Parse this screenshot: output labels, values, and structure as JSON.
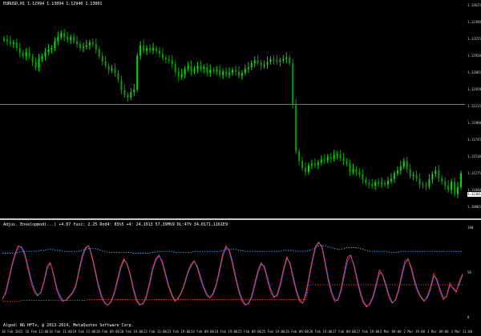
{
  "chart": {
    "symbol_header": "EURUSD,H1  1.12994 1.13094 1.12940 1.13001",
    "indicator_header": "Adjus. Envelopmod(...) +4.07 fusc: 2.25 Rnd4: 85%5 +4: 24.1913 57.39M%9 DL:47% 34.0171.1161E9",
    "copyright": "Algod: NG HFTs, @ 2013-2014, MetaQuotes Software Corp.",
    "current_price": "1.12301",
    "colors": {
      "bull": "#00e000",
      "bear": "#00a000",
      "line1": "#ff3030",
      "line2": "#3a6cff",
      "env_upper": "#3fa9ff",
      "env_lower": "#ff3030"
    },
    "price_axis": [
      "1.13625",
      "1.13390",
      "1.13155",
      "1.12920",
      "1.12685",
      "1.12450",
      "1.12215",
      "1.11980",
      "1.11745",
      "1.11510",
      "1.11275",
      "1.11040",
      "1.10805"
    ],
    "indicator_axis": [
      "100",
      "50",
      "0"
    ],
    "time_axis": [
      "10 Feb 2015",
      "16 Feb 11:00",
      "18 Feb 11:00",
      "19 Feb 15:00",
      "20 Feb 09:00",
      "20 Feb 19:00",
      "23 Feb 11:00",
      "23 Feb 19:00",
      "24 Feb 09:00",
      "24 Feb 19:00",
      "25 Feb 09:00",
      "25 Feb 19:00",
      "26 Feb 09:00",
      "26 Feb 19:00",
      "27 Feb 09:00",
      "27 Feb 19:00",
      "2 Mar 09:00",
      "2 Mar 19:00",
      "3 Mar 09:00",
      "3 Mar 11:00"
    ]
  },
  "chart_data": {
    "type": "candlestick",
    "title": "EURUSD,H1",
    "ylim": [
      1.1075,
      1.1368
    ],
    "close": [
      1.1325,
      1.1322,
      1.1318,
      1.132,
      1.1312,
      1.1305,
      1.13,
      1.1306,
      1.13,
      1.1292,
      1.1284,
      1.1296,
      1.13,
      1.1306,
      1.131,
      1.1312,
      1.1322,
      1.1328,
      1.1334,
      1.1328,
      1.1324,
      1.1328,
      1.1322,
      1.1318,
      1.1312,
      1.1314,
      1.1316,
      1.132,
      1.1318,
      1.131,
      1.13,
      1.1293,
      1.1286,
      1.128,
      1.1282,
      1.1276,
      1.1266,
      1.1251,
      1.1244,
      1.124,
      1.1248,
      1.1252,
      1.1301,
      1.1316,
      1.1308,
      1.1312,
      1.1309,
      1.1312,
      1.1308,
      1.1304,
      1.1298,
      1.1296,
      1.1294,
      1.1289,
      1.1278,
      1.127,
      1.1274,
      1.1282,
      1.1286,
      1.1278,
      1.1282,
      1.1286,
      1.1282,
      1.1284,
      1.1276,
      1.128,
      1.1279,
      1.128,
      1.1273,
      1.1278,
      1.1274,
      1.1276,
      1.128,
      1.1278,
      1.1272,
      1.1276,
      1.1282,
      1.1284,
      1.129,
      1.1294,
      1.1291,
      1.1286,
      1.1288,
      1.1292,
      1.1296,
      1.1294,
      1.1292,
      1.1294,
      1.1296,
      1.1298,
      1.129,
      1.123,
      1.1162,
      1.1148,
      1.1138,
      1.1132,
      1.1142,
      1.1144,
      1.1142,
      1.1146,
      1.115,
      1.1149,
      1.1154,
      1.1151,
      1.1156,
      1.1158,
      1.1152,
      1.1148,
      1.1144,
      1.1132,
      1.1136,
      1.1132,
      1.1128,
      1.1121,
      1.1116,
      1.1114,
      1.1112,
      1.1117,
      1.1115,
      1.1116,
      1.1114,
      1.1119,
      1.1122,
      1.113,
      1.1134,
      1.114,
      1.1148,
      1.1136,
      1.1126,
      1.1128,
      1.1122,
      1.1114,
      1.1112,
      1.1111,
      1.1121,
      1.1129,
      1.1134,
      1.1123,
      1.1118,
      1.1112,
      1.1106,
      1.1118,
      1.11,
      1.111,
      1.113
    ],
    "ind1": [
      22,
      30,
      45,
      60,
      72,
      80,
      78,
      70,
      55,
      40,
      30,
      26,
      30,
      42,
      58,
      62,
      48,
      32,
      24,
      20,
      22,
      26,
      30,
      38,
      55,
      70,
      78,
      80,
      68,
      52,
      36,
      24,
      18,
      16,
      20,
      30,
      44,
      58,
      66,
      60,
      48,
      32,
      20,
      16,
      18,
      26,
      40,
      56,
      66,
      70,
      62,
      48,
      36,
      26,
      20,
      24,
      30,
      40,
      52,
      60,
      64,
      56,
      44,
      34,
      26,
      24,
      30,
      40,
      56,
      72,
      80,
      74,
      60,
      44,
      30,
      20,
      16,
      18,
      26,
      40,
      54,
      62,
      56,
      42,
      30,
      24,
      28,
      40,
      56,
      68,
      60,
      44,
      30,
      20,
      18,
      30,
      48,
      66,
      80,
      84,
      78,
      60,
      42,
      28,
      20,
      22,
      34,
      52,
      68,
      70,
      58,
      42,
      28,
      18,
      14,
      18,
      26,
      40,
      54,
      48,
      36,
      24,
      18,
      22,
      34,
      50,
      64,
      66,
      54,
      40,
      30,
      24,
      20,
      26,
      36,
      50,
      42,
      30,
      22,
      26,
      40,
      34,
      30,
      42,
      50
    ],
    "ind2": [
      24,
      28,
      42,
      58,
      70,
      79,
      79,
      72,
      58,
      44,
      33,
      27,
      29,
      40,
      55,
      61,
      50,
      35,
      26,
      21,
      21,
      25,
      29,
      36,
      52,
      67,
      77,
      80,
      70,
      55,
      39,
      27,
      19,
      16,
      19,
      28,
      41,
      55,
      64,
      61,
      50,
      35,
      22,
      17,
      17,
      24,
      37,
      53,
      64,
      69,
      64,
      51,
      38,
      28,
      21,
      23,
      29,
      38,
      50,
      58,
      63,
      58,
      47,
      36,
      28,
      24,
      28,
      38,
      53,
      69,
      78,
      76,
      63,
      47,
      33,
      22,
      17,
      17,
      24,
      37,
      51,
      60,
      58,
      45,
      33,
      25,
      26,
      37,
      53,
      66,
      62,
      47,
      33,
      22,
      18,
      27,
      45,
      63,
      78,
      83,
      80,
      63,
      45,
      31,
      22,
      21,
      31,
      48,
      64,
      69,
      60,
      45,
      31,
      20,
      15,
      17,
      24,
      37,
      51,
      49,
      39,
      27,
      19,
      21,
      31,
      47,
      61,
      65,
      57,
      43,
      32,
      25,
      21,
      24,
      33,
      47,
      44,
      33,
      24,
      25,
      37,
      35,
      31,
      39,
      48
    ],
    "upper_env": [
      72,
      72,
      72,
      72,
      72,
      73,
      74,
      74,
      74,
      74,
      74,
      74,
      75,
      75,
      76,
      76,
      76,
      75,
      75,
      74,
      74,
      74,
      74,
      74,
      74,
      75,
      76,
      77,
      77,
      77,
      76,
      75,
      74,
      73,
      73,
      73,
      73,
      73,
      73,
      73,
      73,
      72,
      72,
      72,
      72,
      72,
      72,
      73,
      73,
      74,
      74,
      74,
      74,
      74,
      73,
      73,
      73,
      73,
      73,
      73,
      74,
      74,
      74,
      74,
      74,
      74,
      74,
      74,
      74,
      75,
      76,
      76,
      76,
      76,
      75,
      75,
      74,
      74,
      74,
      74,
      74,
      74,
      74,
      74,
      74,
      74,
      74,
      74,
      75,
      75,
      75,
      75,
      74,
      74,
      74,
      74,
      75,
      76,
      78,
      80,
      80,
      80,
      79,
      78,
      77,
      76,
      76,
      77,
      78,
      78,
      78,
      78,
      77,
      76,
      75,
      74,
      74,
      74,
      74,
      74,
      74,
      73,
      73,
      73,
      73,
      74,
      74,
      74,
      74,
      74,
      74,
      74,
      74,
      74,
      74,
      74,
      74,
      74,
      74,
      74,
      74,
      74,
      74,
      74,
      74
    ],
    "lower_env": [
      20,
      20,
      20,
      20,
      20,
      20,
      21,
      21,
      21,
      21,
      21,
      21,
      21,
      21,
      21,
      21,
      21,
      21,
      21,
      21,
      21,
      21,
      21,
      21,
      21,
      21,
      21,
      22,
      22,
      22,
      22,
      22,
      22,
      22,
      22,
      22,
      22,
      22,
      22,
      22,
      22,
      22,
      22,
      22,
      22,
      22,
      22,
      22,
      22,
      22,
      22,
      22,
      22,
      22,
      22,
      22,
      22,
      22,
      22,
      22,
      22,
      22,
      22,
      22,
      22,
      22,
      22,
      22,
      22,
      22,
      22,
      22,
      22,
      22,
      22,
      22,
      22,
      22,
      22,
      22,
      22,
      22,
      22,
      22,
      22,
      22,
      22,
      22,
      22,
      22,
      22,
      22,
      22,
      22,
      22,
      22,
      38,
      38,
      38,
      38,
      38,
      38,
      38,
      38,
      38,
      38,
      38,
      38,
      38,
      38,
      38,
      38,
      38,
      38,
      38,
      38,
      38,
      38,
      38,
      38,
      38,
      38,
      38,
      38,
      38,
      38,
      38,
      38,
      38,
      38,
      38,
      38,
      38,
      38,
      38,
      38,
      38,
      38,
      38,
      38,
      38,
      38,
      38,
      38,
      38
    ]
  }
}
